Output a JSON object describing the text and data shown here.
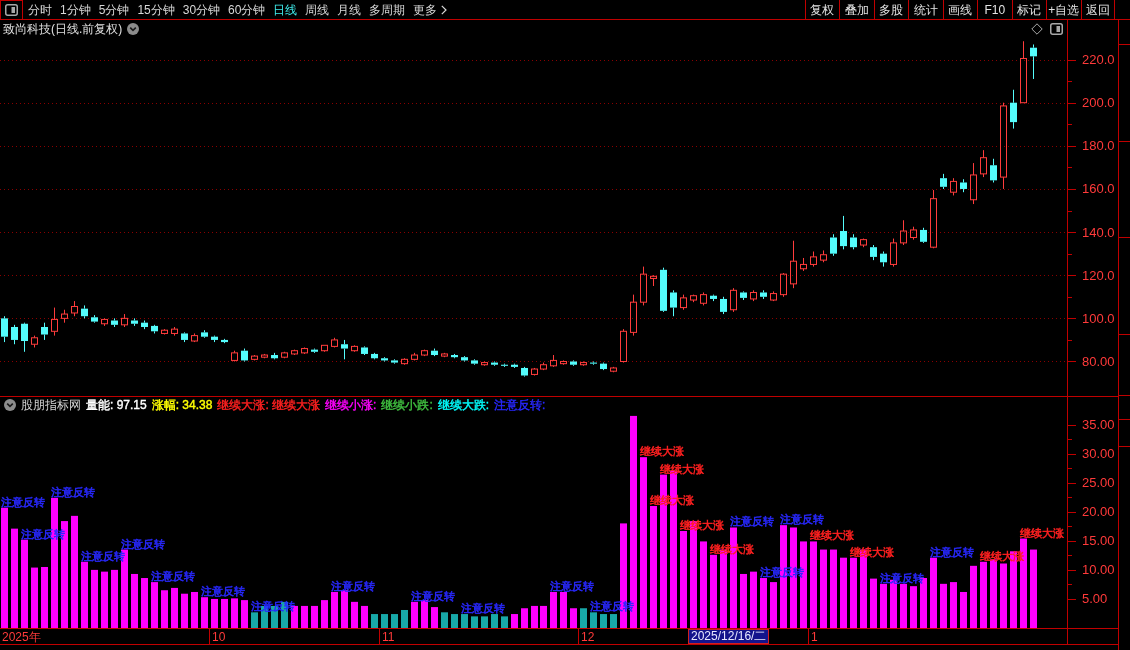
{
  "toolbar": {
    "periods": [
      {
        "label": "分时",
        "selected": false
      },
      {
        "label": "1分钟",
        "selected": false
      },
      {
        "label": "5分钟",
        "selected": false
      },
      {
        "label": "15分钟",
        "selected": false
      },
      {
        "label": "30分钟",
        "selected": false
      },
      {
        "label": "60分钟",
        "selected": false
      },
      {
        "label": "日线",
        "selected": true
      },
      {
        "label": "周线",
        "selected": false
      },
      {
        "label": "月线",
        "selected": false
      },
      {
        "label": "多周期",
        "selected": false
      }
    ],
    "more_label": "更多",
    "actions": [
      "复权",
      "叠加",
      "多股",
      "统计",
      "画线",
      "F10",
      "标记",
      "+自选",
      "返回"
    ]
  },
  "price_pane": {
    "title": "致尚科技(日线.前复权)",
    "chart_data": [
      {
        "type": "candlestick",
        "ylim": [
          64,
          230
        ],
        "yticks": [
          {
            "value": 80,
            "label": "80.00"
          },
          {
            "value": 100,
            "label": "100.0"
          },
          {
            "value": 120,
            "label": "120.0"
          },
          {
            "value": 140,
            "label": "140.0"
          },
          {
            "value": 160,
            "label": "160.0"
          },
          {
            "value": 180,
            "label": "180.0"
          },
          {
            "value": 200,
            "label": "200.0"
          },
          {
            "value": 220,
            "label": "220.0"
          }
        ],
        "grid": true,
        "ohlc": [
          [
            100,
            101,
            89,
            91.5
          ],
          [
            96,
            97,
            88,
            90
          ],
          [
            97.5,
            98,
            84.5,
            89.5
          ],
          [
            88,
            92,
            86.5,
            91
          ],
          [
            96,
            98,
            90,
            92.5
          ],
          [
            94,
            105,
            92,
            99.5
          ],
          [
            100,
            104,
            98,
            102
          ],
          [
            102.5,
            108,
            101,
            105.5
          ],
          [
            104.5,
            106,
            100,
            101
          ],
          [
            100.5,
            101.5,
            98,
            98.5
          ],
          [
            97.5,
            100,
            96.5,
            99.5
          ],
          [
            99,
            100,
            96,
            97
          ],
          [
            97,
            102,
            96,
            100
          ],
          [
            99,
            100,
            96.5,
            97.5
          ],
          [
            98,
            99,
            95,
            96
          ],
          [
            96.5,
            97,
            93,
            94
          ],
          [
            93,
            95,
            92.5,
            94.5
          ],
          [
            93,
            96,
            92,
            95
          ],
          [
            93,
            93.5,
            89,
            90
          ],
          [
            89.5,
            93,
            89,
            92
          ],
          [
            93.5,
            94.5,
            91,
            91.5
          ],
          [
            91.5,
            92,
            89,
            90
          ],
          [
            90,
            90.5,
            88.5,
            89
          ],
          [
            80.5,
            85,
            80,
            84
          ],
          [
            85,
            86,
            80,
            80.5
          ],
          [
            81,
            83,
            80.5,
            82.5
          ],
          [
            82,
            83.5,
            81.5,
            83
          ],
          [
            83,
            84,
            81,
            81.5
          ],
          [
            82,
            84.5,
            81.5,
            84
          ],
          [
            83.5,
            85.5,
            83,
            85
          ],
          [
            84,
            86.5,
            83.5,
            86
          ],
          [
            85.5,
            86,
            84,
            84.5
          ],
          [
            85,
            87.5,
            84.5,
            87.5
          ],
          [
            87,
            91,
            86.5,
            90
          ],
          [
            88,
            90,
            81,
            86
          ],
          [
            85,
            87.5,
            84.5,
            87
          ],
          [
            86.5,
            87,
            83,
            83.5
          ],
          [
            83.5,
            84,
            81,
            81.5
          ],
          [
            81.5,
            82,
            80,
            80.5
          ],
          [
            80.5,
            81,
            79,
            79.5
          ],
          [
            79,
            81.5,
            78.5,
            81
          ],
          [
            81,
            84,
            80.5,
            83
          ],
          [
            83,
            85.5,
            82.5,
            85
          ],
          [
            85,
            86,
            82.5,
            83
          ],
          [
            82.5,
            84,
            82,
            83.5
          ],
          [
            83,
            83.5,
            81.5,
            82
          ],
          [
            82,
            82.5,
            80,
            80.5
          ],
          [
            80.5,
            81,
            78.5,
            79
          ],
          [
            78.5,
            80,
            78,
            79.5
          ],
          [
            79.5,
            80,
            78,
            78.5
          ],
          [
            78.5,
            79,
            77.5,
            78
          ],
          [
            78.5,
            79,
            77,
            77.5
          ],
          [
            77,
            77.5,
            73,
            73.5
          ],
          [
            74,
            77,
            73.5,
            76.5
          ],
          [
            76.5,
            79.5,
            76,
            78.5
          ],
          [
            78,
            83,
            77.5,
            80.5
          ],
          [
            79,
            80.5,
            78.5,
            80
          ],
          [
            80,
            80.5,
            78,
            78.5
          ],
          [
            78.5,
            80,
            78,
            79.5
          ],
          [
            79.5,
            80,
            78.5,
            79
          ],
          [
            79,
            79.5,
            76,
            76.5
          ],
          [
            75.5,
            77.5,
            75,
            77
          ],
          [
            80,
            95,
            79.5,
            94
          ],
          [
            93.5,
            111,
            92,
            107.5
          ],
          [
            107.5,
            124,
            106,
            120.5
          ],
          [
            118.5,
            120,
            115,
            119.5
          ],
          [
            122.5,
            123.5,
            103,
            103.5
          ],
          [
            112,
            113,
            101,
            105
          ],
          [
            105,
            111,
            104,
            109.5
          ],
          [
            108.5,
            111,
            107.5,
            110.5
          ],
          [
            107,
            112,
            106,
            111
          ],
          [
            110.5,
            111,
            108,
            109
          ],
          [
            109,
            110,
            102,
            103
          ],
          [
            104,
            114,
            103,
            113
          ],
          [
            112,
            112.5,
            108.5,
            109.5
          ],
          [
            109,
            113,
            108,
            112
          ],
          [
            112,
            113,
            109,
            110
          ],
          [
            108.5,
            112.5,
            108,
            111.5
          ],
          [
            111,
            121,
            110,
            120.5
          ],
          [
            116,
            136,
            114,
            126.5
          ],
          [
            123,
            128,
            122,
            125
          ],
          [
            125,
            131,
            124,
            128.5
          ],
          [
            127,
            131.5,
            126,
            129.5
          ],
          [
            137.5,
            139,
            129,
            130
          ],
          [
            140.5,
            147.5,
            132,
            133.5
          ],
          [
            137.5,
            139,
            132,
            133
          ],
          [
            134,
            137,
            133,
            136.5
          ],
          [
            133,
            134,
            127,
            128.5
          ],
          [
            130,
            131,
            124,
            126
          ],
          [
            125,
            137,
            124,
            135
          ],
          [
            135,
            145.5,
            134,
            140.5
          ],
          [
            137.5,
            142.5,
            136.5,
            141
          ],
          [
            141,
            142,
            135,
            135.5
          ],
          [
            133,
            159.5,
            132.5,
            155.5
          ],
          [
            165,
            167,
            160,
            161
          ],
          [
            158.5,
            165,
            157,
            163.5
          ],
          [
            163,
            164.5,
            158.5,
            160
          ],
          [
            155,
            172,
            153,
            166.5
          ],
          [
            167,
            178,
            165.5,
            174.5
          ],
          [
            171,
            174,
            163,
            164
          ],
          [
            165.5,
            200,
            160,
            198.5
          ],
          [
            200,
            206,
            188,
            191
          ],
          [
            200,
            228.5,
            200,
            220.5
          ],
          [
            225.5,
            227,
            211,
            221.5
          ],
          null,
          null,
          null
        ]
      }
    ]
  },
  "indicator_pane": {
    "name": "股朋指标网",
    "readouts": [
      {
        "text": "量能: 97.15",
        "color": "#ffffff"
      },
      {
        "text": "涨幅: 34.38",
        "color": "#ffff00"
      },
      {
        "text": "继续大涨: 继续大涨",
        "color": "#ff2020"
      },
      {
        "text": "继续小涨:",
        "color": "#ff00ff"
      },
      {
        "text": "继续小跌:",
        "color": "#40c040"
      },
      {
        "text": "继续大跌:",
        "color": "#00ffff"
      },
      {
        "text": "注意反转:",
        "color": "#2828ff"
      }
    ],
    "chart_data": [
      {
        "type": "bar",
        "ylim": [
          0,
          37
        ],
        "yticks": [
          {
            "value": 5,
            "label": "5.00"
          },
          {
            "value": 10,
            "label": "10.00"
          },
          {
            "value": 15,
            "label": "15.00"
          },
          {
            "value": 20,
            "label": "20.00"
          },
          {
            "value": 25,
            "label": "25.00"
          },
          {
            "value": 30,
            "label": "30.00"
          },
          {
            "value": 35,
            "label": "35.00"
          }
        ],
        "values": [
          20.7,
          17.1,
          15.2,
          10.4,
          10.5,
          22.4,
          18.4,
          19.3,
          11.4,
          10,
          9.7,
          10,
          13.5,
          9.3,
          8.6,
          7.9,
          6.5,
          6.9,
          5.9,
          6.2,
          5.3,
          5,
          5,
          5.1,
          4.8,
          2.7,
          3.8,
          3.8,
          4.5,
          3.8,
          3.8,
          3.8,
          4.8,
          6.2,
          6.5,
          4.5,
          3.8,
          2.4,
          2.4,
          2.4,
          3.1,
          4.5,
          4.8,
          3.6,
          2.7,
          2.4,
          2.4,
          2,
          2,
          2.4,
          2,
          2.4,
          3.4,
          3.8,
          3.8,
          6.2,
          6.2,
          3.4,
          3.4,
          2.7,
          2.4,
          2.4,
          18,
          36.5,
          29.4,
          21,
          26.4,
          27.1,
          16.7,
          18.4,
          14.9,
          12.6,
          13.5,
          17.3,
          9.3,
          9.7,
          8.6,
          7.9,
          17.7,
          17.3,
          14.9,
          14.9,
          13.5,
          13.5,
          12.1,
          12.1,
          13.5,
          8.5,
          7.6,
          8.3,
          7.6,
          7.2,
          8.6,
          12.1,
          7.6,
          7.9,
          6.2,
          10.7,
          11.4,
          11.8,
          11.1,
          13.2,
          15.4,
          13.5,
          null,
          null,
          null
        ],
        "colors": [
          "#ff00ff",
          "#ff00ff",
          "#ff00ff",
          "#ff00ff",
          "#ff00ff",
          "#ff00ff",
          "#ff00ff",
          "#ff00ff",
          "#ff00ff",
          "#ff00ff",
          "#ff00ff",
          "#ff00ff",
          "#ff00ff",
          "#ff00ff",
          "#ff00ff",
          "#ff00ff",
          "#ff00ff",
          "#ff00ff",
          "#ff00ff",
          "#ff00ff",
          "#ff00ff",
          "#ff00ff",
          "#ff00ff",
          "#ff00ff",
          "#ff00ff",
          "#18a8a8",
          "#18a8a8",
          "#18a8a8",
          "#18a8a8",
          "#ff00ff",
          "#ff00ff",
          "#ff00ff",
          "#ff00ff",
          "#ff00ff",
          "#ff00ff",
          "#ff00ff",
          "#ff00ff",
          "#18a8a8",
          "#18a8a8",
          "#18a8a8",
          "#18a8a8",
          "#ff00ff",
          "#ff00ff",
          "#ff00ff",
          "#18a8a8",
          "#18a8a8",
          "#18a8a8",
          "#18a8a8",
          "#18a8a8",
          "#18a8a8",
          "#18a8a8",
          "#ff00ff",
          "#ff00ff",
          "#ff00ff",
          "#ff00ff",
          "#ff00ff",
          "#ff00ff",
          "#ff00ff",
          "#18a8a8",
          "#18a8a8",
          "#18a8a8",
          "#18a8a8",
          "#ff00ff",
          "#ff00ff",
          "#ff00ff",
          "#ff00ff",
          "#ff00ff",
          "#ff00ff",
          "#ff00ff",
          "#ff00ff",
          "#ff00ff",
          "#ff00ff",
          "#ff00ff",
          "#ff00ff",
          "#ff00ff",
          "#ff00ff",
          "#ff00ff",
          "#ff00ff",
          "#ff00ff",
          "#ff00ff",
          "#ff00ff",
          "#ff00ff",
          "#ff00ff",
          "#ff00ff",
          "#ff00ff",
          "#ff00ff",
          "#ff00ff",
          "#ff00ff",
          "#ff00ff",
          "#ff00ff",
          "#ff00ff",
          "#ff00ff",
          "#ff00ff",
          "#ff00ff",
          "#ff00ff",
          "#ff00ff",
          "#ff00ff",
          "#ff00ff",
          "#ff00ff",
          "#ff00ff",
          "#ff00ff",
          "#ff00ff",
          "#ff00ff",
          "#ff00ff",
          null,
          null,
          null
        ]
      }
    ],
    "signals": [
      {
        "text": "注意反转",
        "color": "#2828ff"
      },
      {
        "text": "注意反转",
        "color": "#2828ff"
      },
      {
        "text": "注意反转",
        "color": "#2828ff"
      },
      {
        "text": "注意反转",
        "color": "#2828ff"
      },
      {
        "text": "注意反转",
        "color": "#2828ff"
      },
      {
        "text": "注意反转",
        "color": "#2828ff"
      },
      {
        "text": "注意反转",
        "color": "#2828ff"
      },
      {
        "text": "注意反转",
        "color": "#2828ff"
      },
      {
        "text": "注意反转",
        "color": "#2828ff"
      },
      {
        "text": "注意反转",
        "color": "#2828ff"
      },
      {
        "text": "注意反转",
        "color": "#2828ff"
      },
      {
        "text": "注意反转",
        "color": "#2828ff"
      },
      {
        "text": "注意反转",
        "color": "#2828ff"
      },
      {
        "text": "继续大涨",
        "color": "#ff2020"
      },
      {
        "text": "继续大涨",
        "color": "#ff2020"
      },
      {
        "text": "继续大涨",
        "color": "#ff2020"
      },
      {
        "text": "继续大涨",
        "color": "#ff2020"
      },
      {
        "text": "继续大涨",
        "color": "#ff2020"
      },
      {
        "text": "注意反转",
        "color": "#2828ff"
      },
      {
        "text": "注意反转",
        "color": "#2828ff"
      },
      {
        "text": "注意反转",
        "color": "#2828ff"
      },
      {
        "text": "继续大涨",
        "color": "#ff2020"
      },
      {
        "text": "继续大涨",
        "color": "#ff2020"
      },
      {
        "text": "注意反转",
        "color": "#2828ff"
      },
      {
        "text": "注意反转",
        "color": "#2828ff"
      },
      {
        "text": "继续大涨",
        "color": "#ff2020"
      },
      {
        "text": "继续大涨",
        "color": "#ff2020"
      }
    ]
  },
  "time_axis": {
    "labels": [
      "2025年",
      "10",
      "11",
      "12",
      "1"
    ],
    "cursor": "2025/12/16/二"
  }
}
